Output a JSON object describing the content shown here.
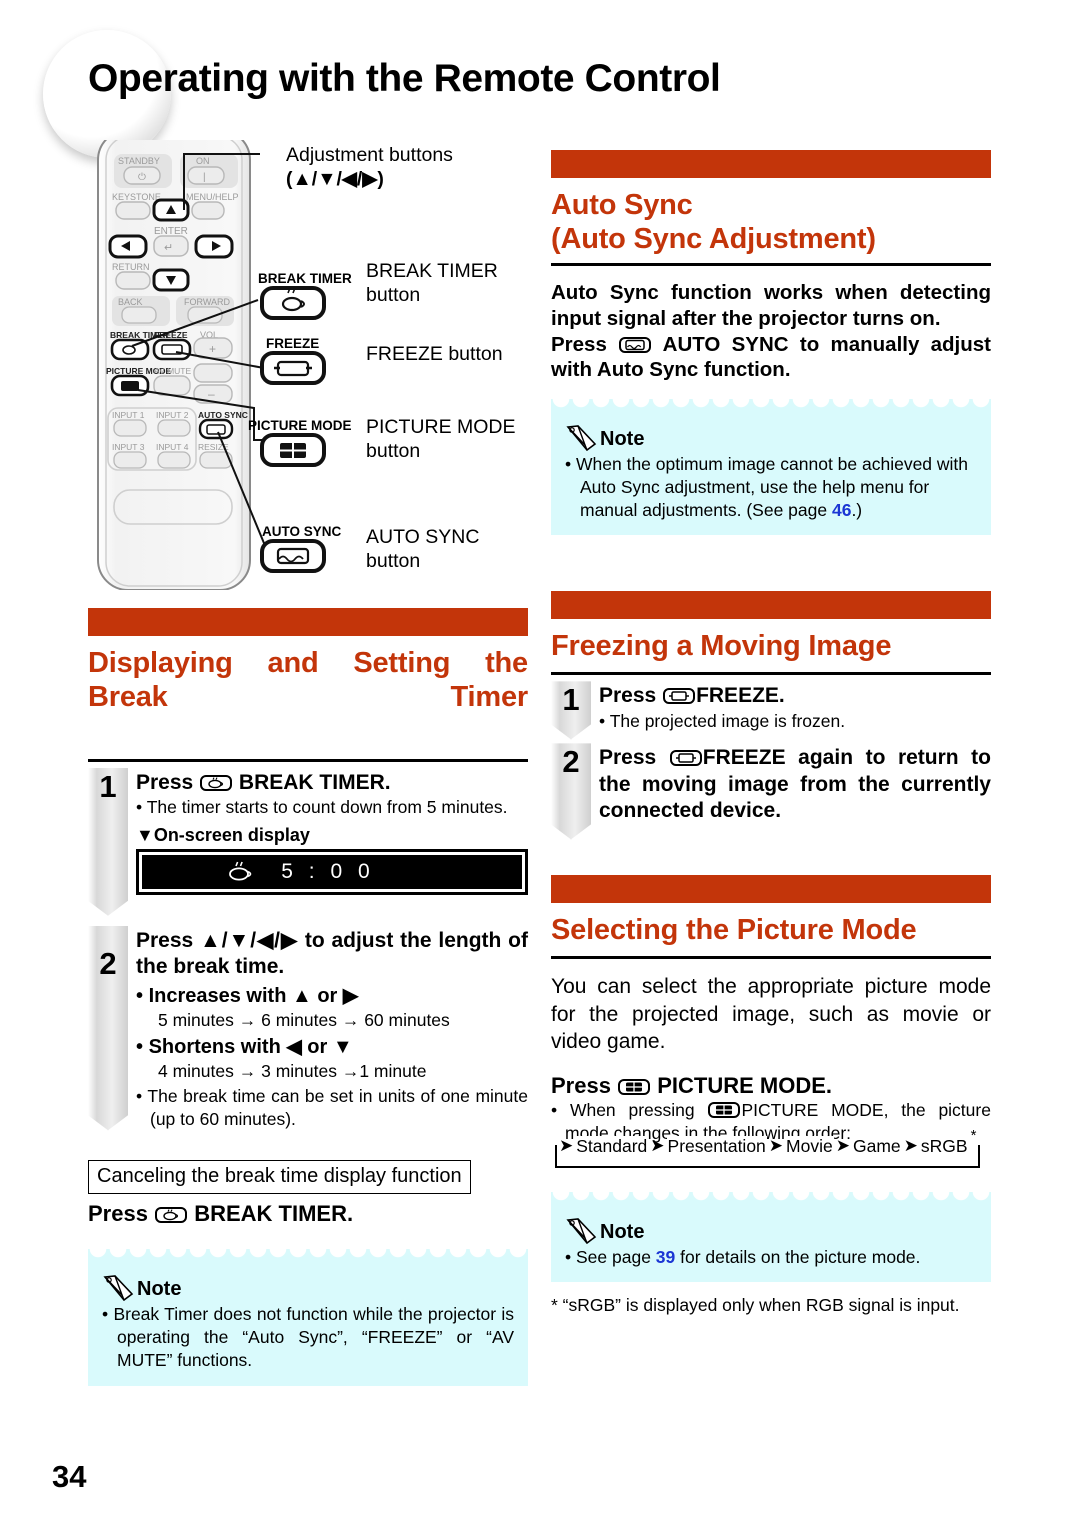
{
  "page": {
    "title": "Operating with the Remote Control",
    "number": "34"
  },
  "remote_figure": {
    "callouts": [
      {
        "name": "adjustment-buttons",
        "line1": "Adjustment buttons",
        "line2": "(▲/▼/◀/▶)"
      },
      {
        "name": "break-timer",
        "label": "BREAK TIMER",
        "line1": "BREAK TIMER",
        "line2": "button"
      },
      {
        "name": "freeze",
        "label": "FREEZE",
        "line1": "FREEZE button",
        "line2": ""
      },
      {
        "name": "picture-mode",
        "label": "PICTURE MODE",
        "line1": "PICTURE MODE",
        "line2": "button"
      },
      {
        "name": "auto-sync",
        "label": "AUTO SYNC",
        "line1": "AUTO SYNC",
        "line2": "button"
      }
    ],
    "remote_buttons": [
      "STANDBY",
      "ON",
      "KEYSTONE",
      "MENU/HELP",
      "ENTER",
      "RETURN",
      "BACK",
      "FORWARD",
      "BREAK TIMER",
      "FREEZE",
      "VOL",
      "PICTURE MODE",
      "AV MUTE",
      "INPUT 1",
      "INPUT 2",
      "AUTO SYNC",
      "INPUT 3",
      "INPUT 4",
      "RESIZE"
    ]
  },
  "auto_sync": {
    "title_line1": "Auto Sync",
    "title_line2": "(Auto Sync Adjustment)",
    "body": "Auto Sync function works when detecting input signal after the projector turns on.",
    "press_prefix": "Press",
    "press_suffix": "AUTO SYNC to manually adjust with Auto Sync function.",
    "note": {
      "label": "Note",
      "items": [
        {
          "text_before": "When the optimum image cannot be achieved with Auto Sync adjustment, use the help menu for manual adjustments. (See page ",
          "page_ref": "46",
          "text_after": ".)"
        }
      ]
    }
  },
  "break_timer": {
    "title": "Displaying and Setting the Break Timer",
    "steps": [
      {
        "number": "1",
        "head_prefix": "Press",
        "head_suffix": "BREAK TIMER.",
        "bullets": [
          "The timer starts to count down from 5 minutes."
        ],
        "osd_caption": "▼On-screen display",
        "osd_time": "5 : 0 0"
      },
      {
        "number": "2",
        "head": "Press ▲/▼/◀/▶ to adjust the length of the break time.",
        "bullets": [
          {
            "bold": "Increases with ▲ or ▶",
            "sub": "5 minutes → 6 minutes → 60 minutes"
          },
          {
            "bold": "Shortens with ◀ or ▼",
            "sub": "4 minutes → 3 minutes →1 minute"
          }
        ],
        "final_bullet": "The break time can be set in units of one minute (up to 60 minutes)."
      }
    ],
    "cancel_box_title": "Canceling the break time display function",
    "cancel_press_prefix": "Press",
    "cancel_press_suffix": "BREAK TIMER.",
    "note": {
      "label": "Note",
      "items": [
        {
          "text_before": "Break Timer does not function while the projector is operating the “Auto Sync”, “FREEZE” or “AV MUTE” functions.",
          "page_ref": "",
          "text_after": ""
        }
      ]
    }
  },
  "freezing": {
    "title": "Freezing a Moving Image",
    "steps": [
      {
        "number": "1",
        "head_prefix": "Press",
        "head_suffix": "FREEZE.",
        "bullets": [
          "The projected image is frozen."
        ]
      },
      {
        "number": "2",
        "head_prefix": "Press",
        "head_suffix": "FREEZE again to return to the moving image from the currently connected device.",
        "bullets": []
      }
    ]
  },
  "picture_mode": {
    "title": "Selecting the Picture Mode",
    "body": "You can select the appropriate picture mode for the projected image, such as movie or video game.",
    "press_prefix": "Press",
    "press_suffix": "PICTURE MODE.",
    "bullet_before": "When pressing",
    "bullet_after": "PICTURE MODE, the picture mode changes in the following order:",
    "flow": [
      "Standard",
      "Presentation",
      "Movie",
      "Game",
      "sRGB"
    ],
    "flow_star": "*",
    "note": {
      "label": "Note",
      "items": [
        {
          "text_before": "See page ",
          "page_ref": "39",
          "text_after": " for details on the picture mode."
        }
      ]
    },
    "footnote": "* “sRGB” is displayed only when RGB signal is input."
  },
  "colors": {
    "accent": "#c3350a",
    "note_bg": "#d9fafc",
    "page_ref": "#1b36d4"
  }
}
